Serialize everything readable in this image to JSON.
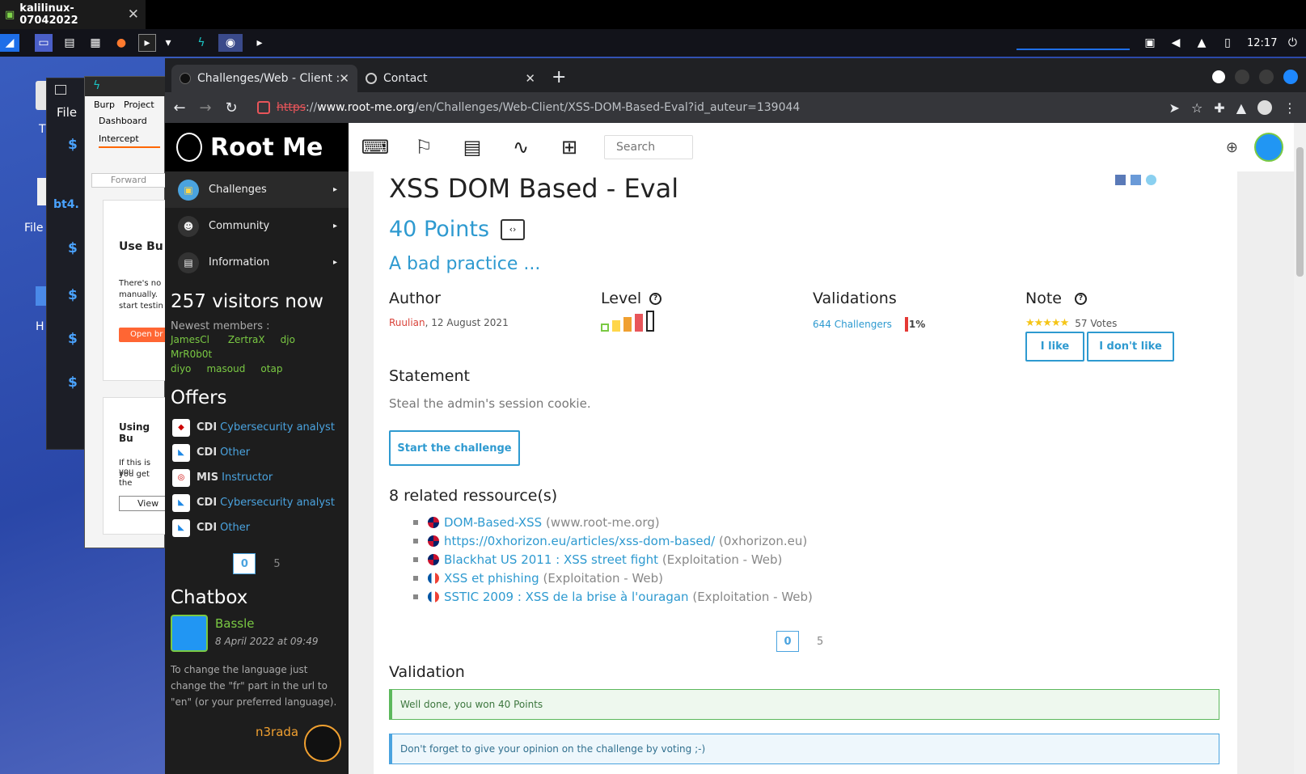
{
  "vm": {
    "tab_title": "kalilinux-07042022",
    "close": "✕"
  },
  "panel": {
    "clock": "12:17"
  },
  "desktop": {
    "icon1": "T",
    "icon2": "File",
    "icon3": "H",
    "term_title": "File",
    "term_prompt": "$",
    "term_host": "bt4."
  },
  "burp": {
    "menu_burp": "Burp",
    "menu_project": "Project",
    "tab_dashboard": "Dashboard",
    "tab_intercept": "Intercept",
    "forward": "Forward",
    "heading1": "Use Bu",
    "para1a": "There's no",
    "para1b": "manually.",
    "para1c": "start testin",
    "open_btn": "Open br",
    "heading2": "Using Bu",
    "para2a": "If this is you",
    "para2b": "you get the",
    "view_btn": "View"
  },
  "browser": {
    "tabs": [
      {
        "title": "Challenges/Web - Client :",
        "close": "✕"
      },
      {
        "title": "Contact",
        "close": "✕"
      }
    ],
    "new_tab": "+",
    "url_scheme": "https",
    "url_sep": "://",
    "url_domain": "www.root-me.org",
    "url_path": "/en/Challenges/Web-Client/XSS-DOM-Based-Eval?id_auteur=139044"
  },
  "sidebar": {
    "logo": "Root Me",
    "nav": [
      {
        "label": "Challenges"
      },
      {
        "label": "Community"
      },
      {
        "label": "Information"
      }
    ],
    "visitors": "257 visitors now",
    "newest_label": "Newest members :",
    "members": [
      "JamesCl",
      "ZertraX",
      "djo",
      "MrR0b0t",
      "diyo",
      "masoud",
      "otap"
    ],
    "offers_title": "Offers",
    "offers": [
      {
        "type": "CDI",
        "title": "Cybersecurity analyst"
      },
      {
        "type": "CDI",
        "title": "Other"
      },
      {
        "type": "MIS",
        "title": "Instructor"
      },
      {
        "type": "CDI",
        "title": "Cybersecurity analyst"
      },
      {
        "type": "CDI",
        "title": "Other"
      }
    ],
    "pager": {
      "current": "0",
      "other": "5"
    },
    "chatbox_title": "Chatbox",
    "chat": {
      "user": "Bassle",
      "date": "8 April 2022 at 09:49",
      "message": "To change the language just change the \"fr\" part in the url to \"en\" (or your preferred language).",
      "user2": "n3rada"
    }
  },
  "topbar": {
    "search_placeholder": "Search"
  },
  "challenge": {
    "title": "XSS DOM Based - Eval",
    "points": "40 Points",
    "subtitle": "A bad practice ...",
    "author_label": "Author",
    "author": "Ruulian",
    "author_date": ", 12 August 2021",
    "level_label": "Level",
    "level_value": 3,
    "validations_label": "Validations",
    "validations": "644 Challengers",
    "validation_pct": "1%",
    "note_label": "Note",
    "votes": "57 Votes",
    "rating": 5,
    "like_btn": "I like",
    "dislike_btn": "I don't like",
    "statement_label": "Statement",
    "statement": "Steal the admin's session cookie.",
    "start_btn": "Start the challenge",
    "resources_label": "8 related ressource(s)",
    "resources": [
      {
        "flag": "uk",
        "link": "DOM-Based-XSS",
        "src": "(www.root-me.org)"
      },
      {
        "flag": "uk",
        "link": "https://0xhorizon.eu/articles/xss-dom-based/",
        "src": "(0xhorizon.eu)"
      },
      {
        "flag": "uk",
        "link": "Blackhat US 2011 : XSS street fight",
        "src": "(Exploitation - Web)"
      },
      {
        "flag": "fr",
        "link": "XSS et phishing",
        "src": "(Exploitation - Web)"
      },
      {
        "flag": "fr",
        "link": "SSTIC 2009 : XSS de la brise à l'ouragan",
        "src": "(Exploitation - Web)"
      }
    ],
    "pager": {
      "current": "0",
      "other": "5"
    },
    "validation_label": "Validation",
    "success_msg": "Well done, you won 40 Points",
    "info_msg": "Don't forget to give your opinion on the challenge by voting ;-)"
  },
  "colors": {
    "accent": "#2e9ad0",
    "green": "#7ac943",
    "author_red": "#d9433a"
  }
}
